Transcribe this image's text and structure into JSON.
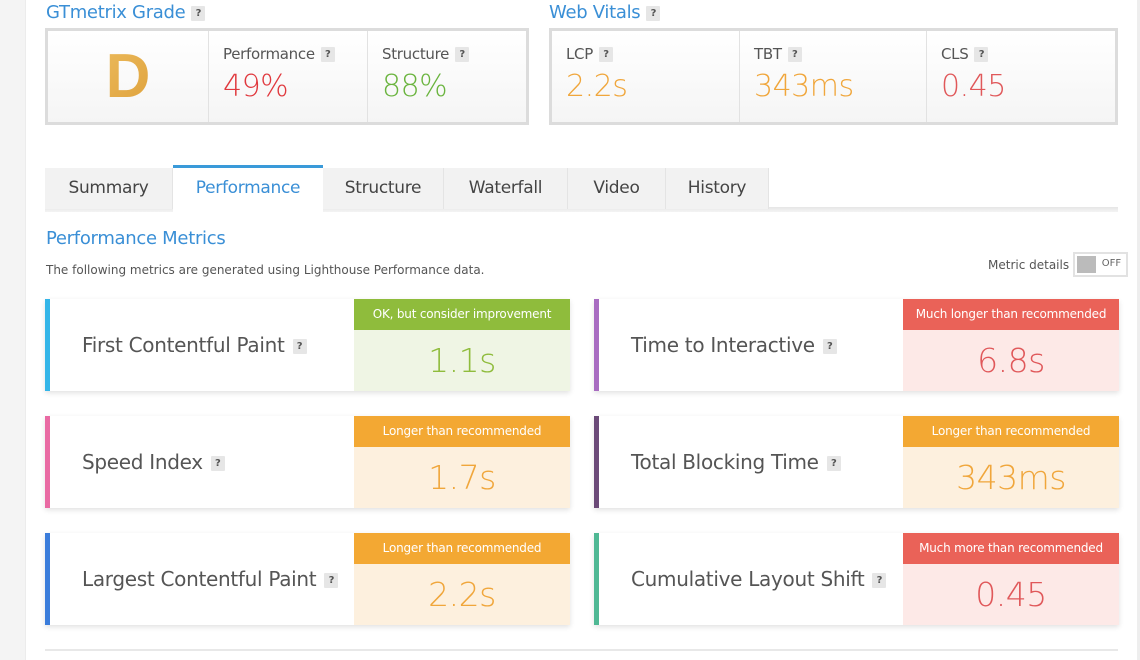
{
  "gtmetrix_grade": {
    "title": "GTmetrix Grade",
    "help": "?",
    "grade": "D",
    "performance": {
      "label": "Performance",
      "value": "49%",
      "color": "#e0393e"
    },
    "structure": {
      "label": "Structure",
      "value": "88%",
      "color": "#6ab43e"
    }
  },
  "web_vitals": {
    "title": "Web Vitals",
    "help": "?",
    "lcp": {
      "label": "LCP",
      "value": "2.2s",
      "color": "#f0a63b"
    },
    "tbt": {
      "label": "TBT",
      "value": "343ms",
      "color": "#f0a63b"
    },
    "cls": {
      "label": "CLS",
      "value": "0.45",
      "color": "#e0585a"
    }
  },
  "tabs": [
    {
      "label": "Summary",
      "active": false
    },
    {
      "label": "Performance",
      "active": true
    },
    {
      "label": "Structure",
      "active": false
    },
    {
      "label": "Waterfall",
      "active": false
    },
    {
      "label": "Video",
      "active": false
    },
    {
      "label": "History",
      "active": false
    }
  ],
  "performance_metrics": {
    "title": "Performance Metrics",
    "subtitle": "The following metrics are generated using Lighthouse Performance data.",
    "metric_details_label": "Metric details",
    "metric_details_state": "OFF",
    "help": "?",
    "items": [
      {
        "name": "First Contentful Paint",
        "badge": "OK, but consider improvement",
        "value": "1.1s",
        "bar_color": "#33b5e8",
        "badge_color": "#8fbc3c",
        "value_bg": "#eff5e4",
        "value_color": "#8fbc3c"
      },
      {
        "name": "Time to Interactive",
        "badge": "Much longer than recommended",
        "value": "6.8s",
        "bar_color": "#a86cc1",
        "badge_color": "#ea6258",
        "value_bg": "#fde9e7",
        "value_color": "#e0585a"
      },
      {
        "name": "Speed Index",
        "badge": "Longer than recommended",
        "value": "1.7s",
        "bar_color": "#e96aa3",
        "badge_color": "#f3a833",
        "value_bg": "#fdf0de",
        "value_color": "#f0a63b"
      },
      {
        "name": "Total Blocking Time",
        "badge": "Longer than recommended",
        "value": "343ms",
        "bar_color": "#6b4a78",
        "badge_color": "#f3a833",
        "value_bg": "#fdf0de",
        "value_color": "#f0a63b"
      },
      {
        "name": "Largest Contentful Paint",
        "badge": "Longer than recommended",
        "value": "2.2s",
        "bar_color": "#3b7ddb",
        "badge_color": "#f3a833",
        "value_bg": "#fdf0de",
        "value_color": "#f0a63b"
      },
      {
        "name": "Cumulative Layout Shift",
        "badge": "Much more than recommended",
        "value": "0.45",
        "bar_color": "#4fb894",
        "badge_color": "#ea6258",
        "value_bg": "#fde9e7",
        "value_color": "#e0585a"
      }
    ]
  }
}
